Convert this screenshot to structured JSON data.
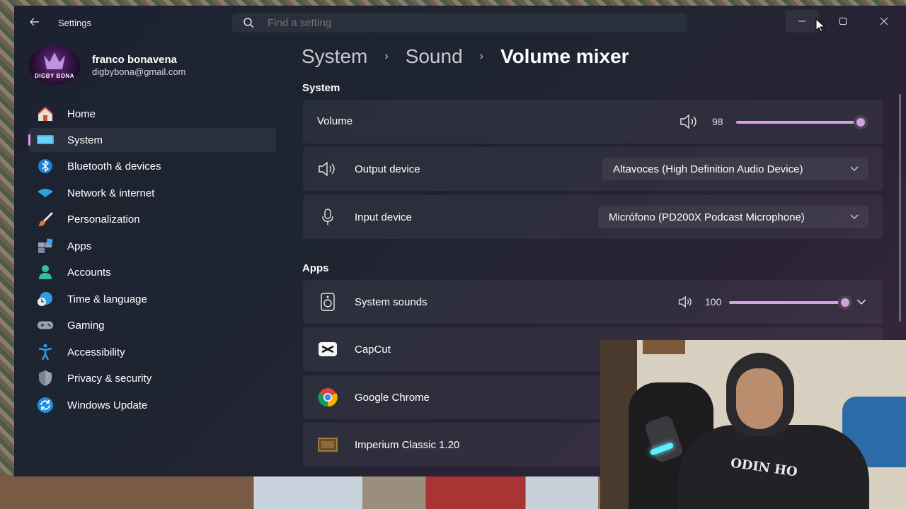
{
  "window": {
    "app_title": "Settings",
    "search_placeholder": "Find a setting"
  },
  "profile": {
    "name": "franco bonavena",
    "email": "digbybona@gmail.com",
    "avatar_text": "DIGBY BONA"
  },
  "sidebar": {
    "items": [
      {
        "label": "Home",
        "icon": "home-icon"
      },
      {
        "label": "System",
        "icon": "system-icon",
        "active": true
      },
      {
        "label": "Bluetooth & devices",
        "icon": "bluetooth-icon"
      },
      {
        "label": "Network & internet",
        "icon": "wifi-icon"
      },
      {
        "label": "Personalization",
        "icon": "brush-icon"
      },
      {
        "label": "Apps",
        "icon": "apps-icon"
      },
      {
        "label": "Accounts",
        "icon": "accounts-icon"
      },
      {
        "label": "Time & language",
        "icon": "globe-clock-icon"
      },
      {
        "label": "Gaming",
        "icon": "gamepad-icon"
      },
      {
        "label": "Accessibility",
        "icon": "accessibility-icon"
      },
      {
        "label": "Privacy & security",
        "icon": "shield-icon"
      },
      {
        "label": "Windows Update",
        "icon": "update-icon"
      }
    ]
  },
  "breadcrumb": {
    "part1": "System",
    "part2": "Sound",
    "current": "Volume mixer",
    "separator": "›"
  },
  "system_section": {
    "title": "System",
    "volume": {
      "label": "Volume",
      "value": "98",
      "level": 0.98
    },
    "output": {
      "label": "Output device",
      "value": "Altavoces (High Definition Audio Device)"
    },
    "input": {
      "label": "Input device",
      "value": "Micrófono (PD200X Podcast Microphone)"
    }
  },
  "apps_section": {
    "title": "Apps",
    "apps": [
      {
        "label": "System sounds",
        "icon": "system-sounds-icon",
        "value": "100",
        "level": 1.0
      },
      {
        "label": "CapCut",
        "icon": "capcut-icon"
      },
      {
        "label": "Google Chrome",
        "icon": "chrome-icon"
      },
      {
        "label": "Imperium Classic 1.20",
        "icon": "imperium-icon"
      }
    ]
  },
  "webcam": {
    "hoodie_text": "ODIN HO"
  },
  "colors": {
    "accent": "#d79fe3",
    "window_bg": "#1f2431"
  }
}
